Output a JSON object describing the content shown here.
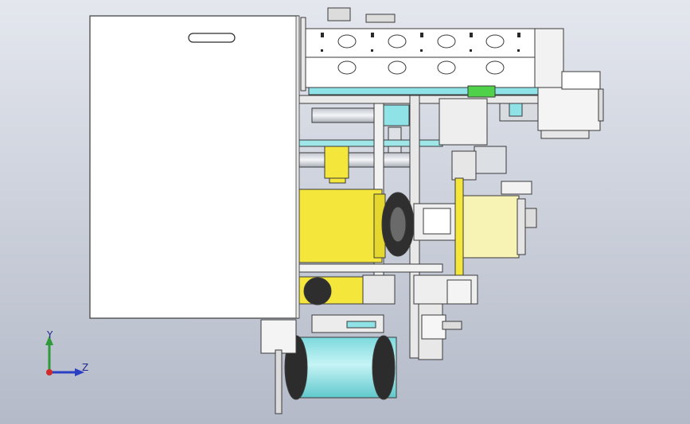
{
  "viewport": {
    "background_top": "#e4e7ee",
    "background_bottom": "#b4bac8",
    "colors": {
      "panel": "#ffffff",
      "outline": "#3a3a3a",
      "yellow": "#f4e63a",
      "pale_yellow": "#f7f3b4",
      "cyan": "#8fe3e6",
      "teal": "#3fc3c6",
      "green": "#4fd24a",
      "dark": "#2a2a2a",
      "grey": "#9aa0a8"
    }
  },
  "triad": {
    "y_label": "Y",
    "z_label": "Z",
    "y_color": "#2e9a3a",
    "z_color": "#2a3fc4",
    "x_color": "#d02a2a"
  }
}
